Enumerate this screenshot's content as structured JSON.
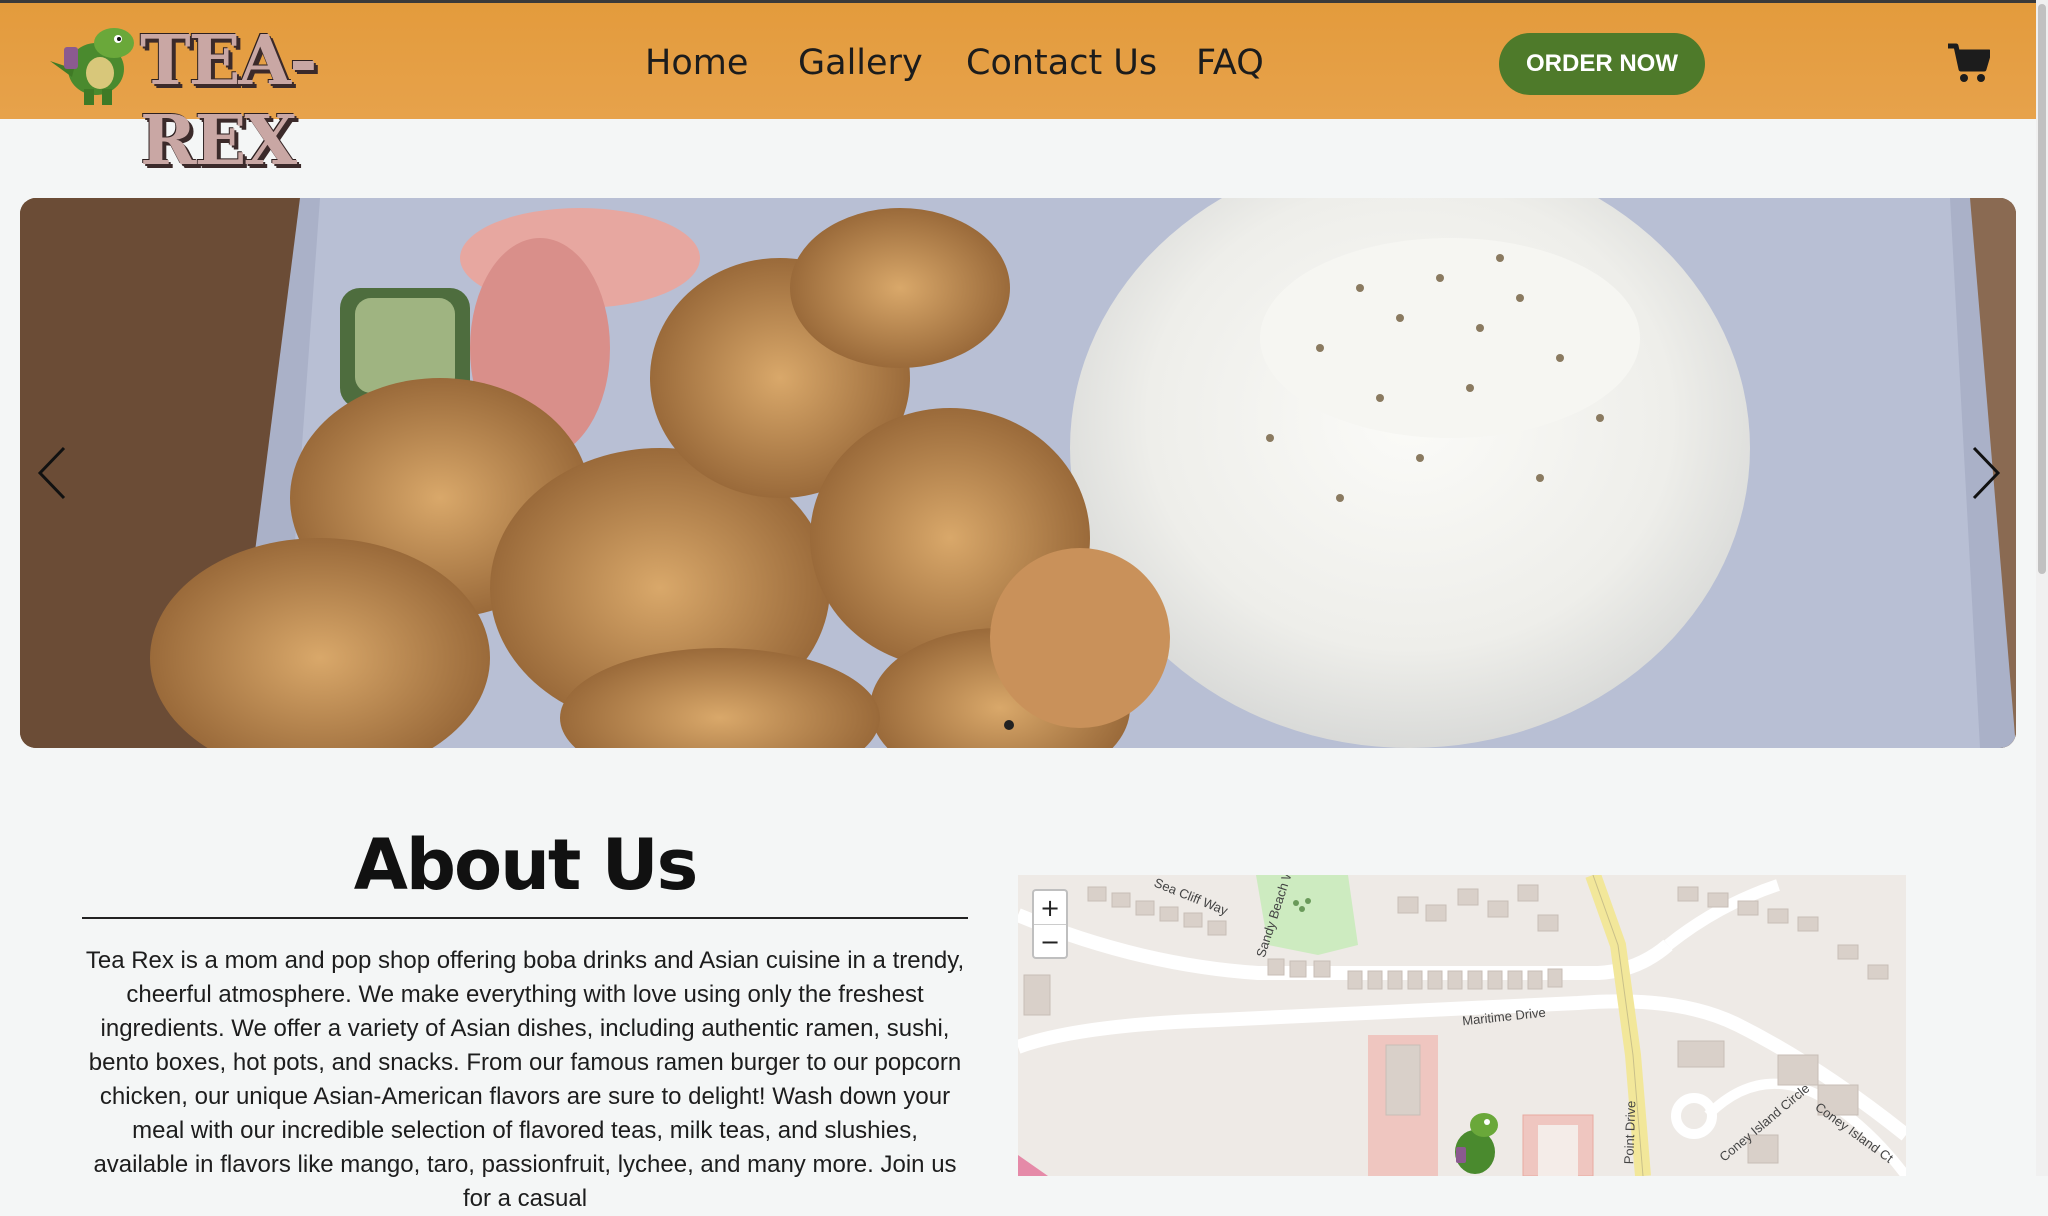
{
  "header": {
    "logo_text": "TEA-REX",
    "nav": [
      "Home",
      "Gallery",
      "Contact Us",
      "FAQ"
    ],
    "order_label": "ORDER NOW",
    "brand_color": "#e39b3c",
    "button_color": "#4e7a2a"
  },
  "carousel": {
    "prev_icon": "chevron-left-icon",
    "next_icon": "chevron-right-icon"
  },
  "about": {
    "title": "About Us",
    "text": "Tea Rex is a mom and pop shop offering boba drinks and Asian cuisine in a trendy, cheerful atmosphere. We make everything with love using only the freshest ingredients. We offer a variety of Asian dishes, including authentic ramen, sushi, bento boxes, hot pots, and snacks. From our famous ramen burger to our popcorn chicken, our unique Asian-American flavors are sure to delight! Wash down your meal with our incredible selection of flavored teas, milk teas, and slushies, available in flavors like mango, taro, passionfruit, lychee, and many more. Join us for a casual"
  },
  "map": {
    "zoom_in": "+",
    "zoom_out": "−",
    "streets": {
      "sea_cliff": "Sea Cliff Way",
      "sandy_beach": "Sandy Beach W",
      "maritime": "Maritime Drive",
      "point": "Point Drive",
      "coney_circle": "Coney Island Circle",
      "coney_ct": "Coney Island Ct"
    }
  }
}
